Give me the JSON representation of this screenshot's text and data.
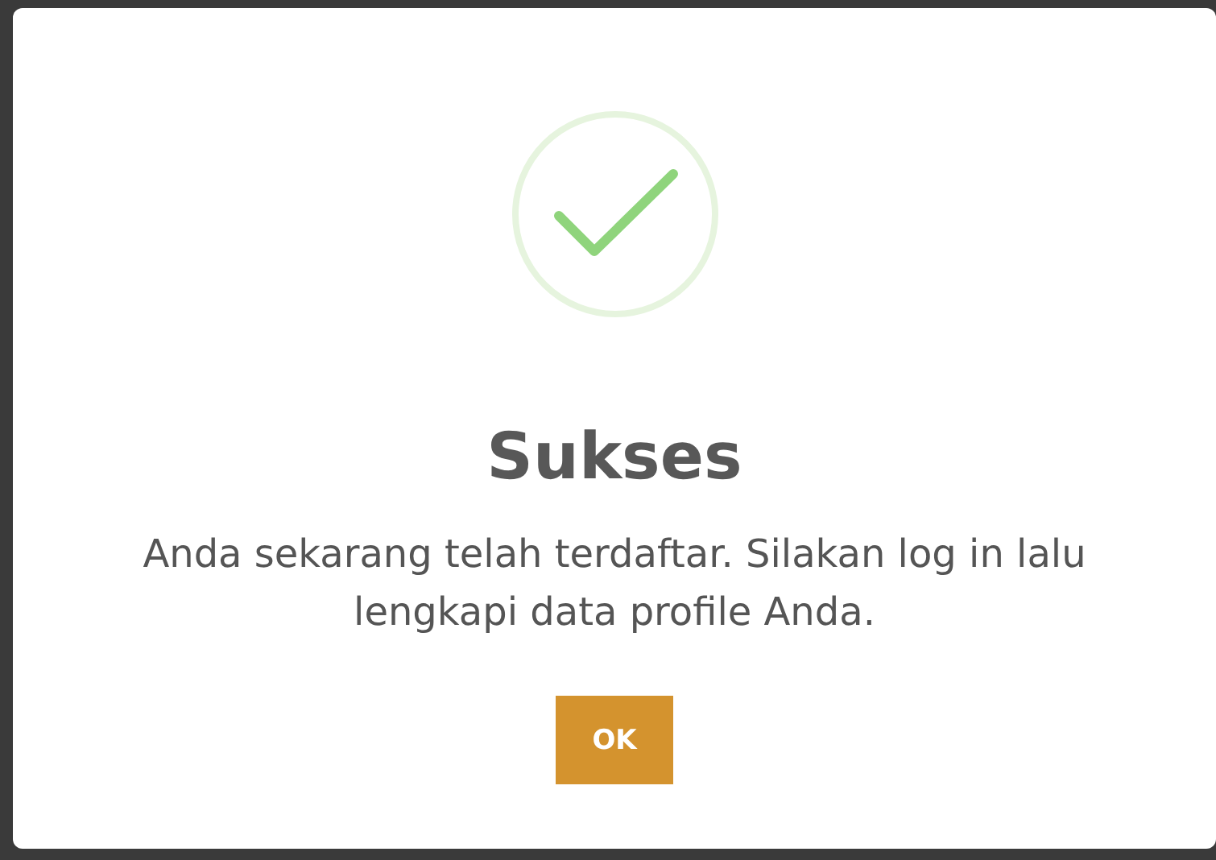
{
  "dialog": {
    "kind": "success",
    "title": "Sukses",
    "message": "Anda sekarang telah terdaftar. Silakan log in lalu lengkapi data profile Anda.",
    "buttons": [
      "OK"
    ]
  }
}
